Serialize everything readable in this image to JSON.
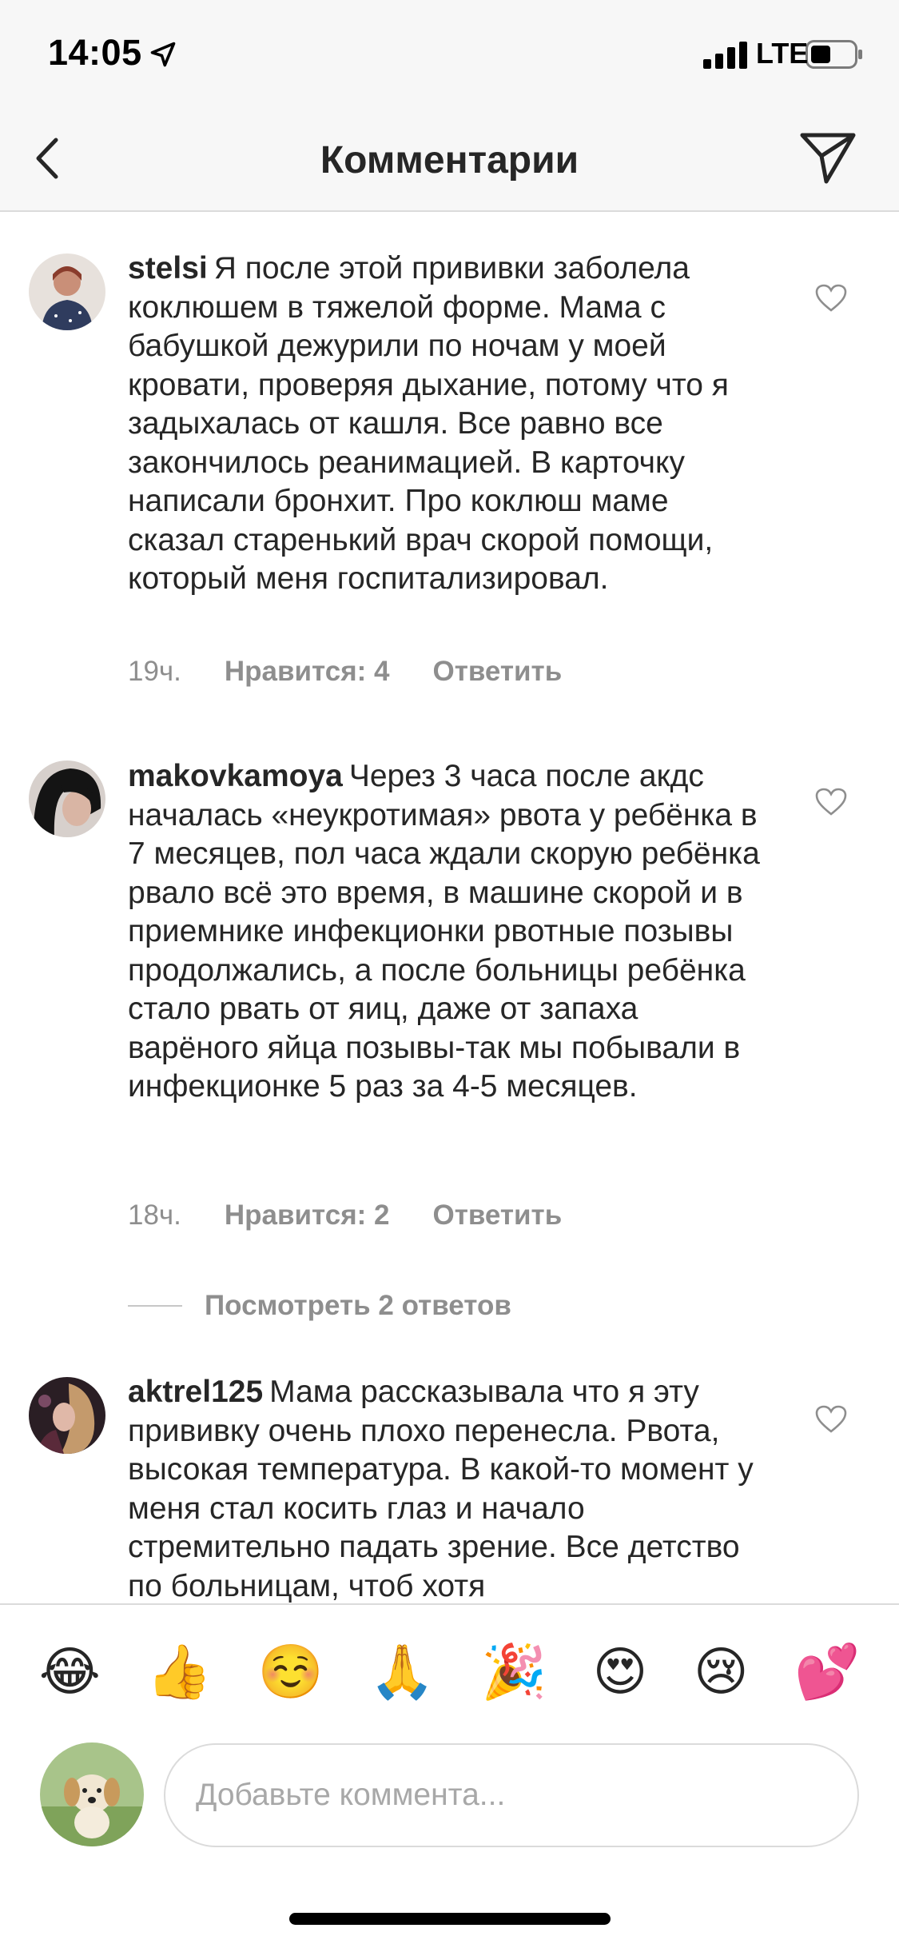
{
  "status_bar": {
    "time": "14:05",
    "network": "LTE"
  },
  "nav": {
    "title": "Комментарии"
  },
  "comments": [
    {
      "username": "stelsi",
      "text": "Я после этой прививки заболела коклюшем в тяжелой форме. Мама с бабушкой дежурили по ночам у моей кровати, проверяя дыхание, потому что я задыхалась от кашля. Все равно все закончилось реанимацией. В карточку написали бронхит. Про коклюш маме сказал старенький врач скорой помощи, который меня госпитализировал.",
      "time": "19ч.",
      "likes": "Нравится: 4",
      "reply": "Ответить"
    },
    {
      "username": "makovkamoya",
      "text": "Через 3 часа после акдс началась «неукротимая» рвота у ребёнка в 7 месяцев, пол часа ждали скорую ребёнка рвало всё это время, в машине скорой и в приемнике инфекционки рвотные позывы продолжались, а после больницы ребёнка стало рвать от яиц, даже от запаха варёного яйца позывы-так мы побывали в инфекционке 5 раз за 4-5 месяцев.",
      "time": "18ч.",
      "likes": "Нравится: 2",
      "reply": "Ответить",
      "view_replies": "Посмотреть 2 ответов"
    },
    {
      "username": "aktrel125",
      "text": "Мама рассказывала что я эту прививку очень плохо перенесла. Рвота, высокая температура. В какой-то момент у меня стал косить глаз и начало стремительно падать зрение. Все детство по больницам, чтоб хотя",
      "time": "",
      "likes": "",
      "reply": ""
    }
  ],
  "emoji_bar": [
    "😂",
    "👍",
    "☺️",
    "🙏",
    "🎉",
    "😍",
    "😢",
    "💕"
  ],
  "input": {
    "placeholder": "Добавьте коммента..."
  },
  "colors": {
    "text": "#262626",
    "secondary": "#8e8e8e",
    "divider": "#dbdbdb",
    "bar_bg": "#f7f7f7"
  }
}
